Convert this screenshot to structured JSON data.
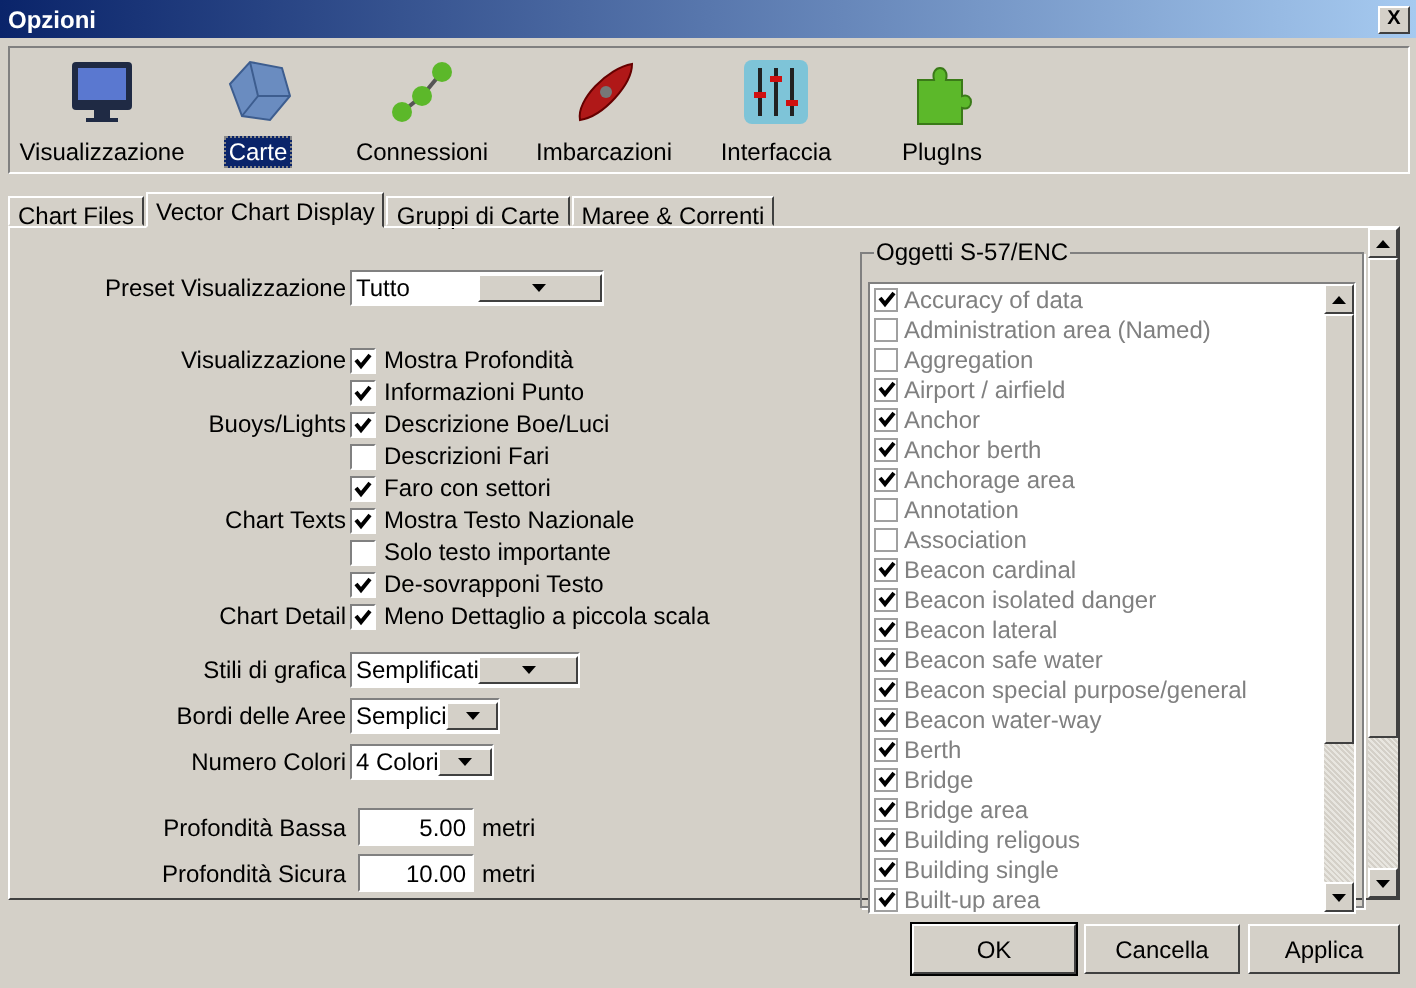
{
  "window": {
    "title": "Opzioni",
    "close": "X"
  },
  "toolbar": [
    {
      "label": "Visualizzazione",
      "selected": false
    },
    {
      "label": "Carte",
      "selected": true
    },
    {
      "label": "Connessioni",
      "selected": false
    },
    {
      "label": "Imbarcazioni",
      "selected": false
    },
    {
      "label": "Interfaccia",
      "selected": false
    },
    {
      "label": "PlugIns",
      "selected": false
    }
  ],
  "tabs": [
    {
      "label": "Chart Files",
      "selected": false
    },
    {
      "label": "Vector Chart Display",
      "selected": true
    },
    {
      "label": "Gruppi di Carte",
      "selected": false
    },
    {
      "label": "Maree & Correnti",
      "selected": false
    }
  ],
  "preset": {
    "label": "Preset Visualizzazione",
    "value": "Tutto"
  },
  "option_groups": [
    {
      "label": "Visualizzazione",
      "options": [
        {
          "label": "Mostra Profondità",
          "checked": true
        },
        {
          "label": "Informazioni Punto",
          "checked": true
        }
      ]
    },
    {
      "label": "Buoys/Lights",
      "options": [
        {
          "label": "Descrizione Boe/Luci",
          "checked": true
        },
        {
          "label": "Descrizioni Fari",
          "checked": false
        },
        {
          "label": "Faro con settori",
          "checked": true
        }
      ]
    },
    {
      "label": "Chart Texts",
      "options": [
        {
          "label": "Mostra Testo Nazionale",
          "checked": true
        },
        {
          "label": "Solo testo importante",
          "checked": false
        },
        {
          "label": "De-sovrapponi Testo",
          "checked": true
        }
      ]
    },
    {
      "label": "Chart Detail",
      "options": [
        {
          "label": "Meno Dettaglio a piccola scala",
          "checked": true
        }
      ]
    }
  ],
  "dropdowns": [
    {
      "label": "Stili di grafica",
      "value": "Semplificati"
    },
    {
      "label": "Bordi delle Aree",
      "value": "Semplici"
    },
    {
      "label": "Numero Colori",
      "value": "4 Colori"
    }
  ],
  "depths": [
    {
      "label": "Profondità Bassa",
      "value": "5.00",
      "unit": "metri"
    },
    {
      "label": "Profondità Sicura",
      "value": "10.00",
      "unit": "metri"
    }
  ],
  "objects": {
    "title": "Oggetti S-57/ENC",
    "items": [
      {
        "label": "Accuracy of data",
        "checked": true
      },
      {
        "label": "Administration area (Named)",
        "checked": false
      },
      {
        "label": "Aggregation",
        "checked": false
      },
      {
        "label": "Airport / airfield",
        "checked": true
      },
      {
        "label": "Anchor",
        "checked": true
      },
      {
        "label": "Anchor berth",
        "checked": true
      },
      {
        "label": "Anchorage area",
        "checked": true
      },
      {
        "label": "Annotation",
        "checked": false
      },
      {
        "label": "Association",
        "checked": false
      },
      {
        "label": "Beacon cardinal",
        "checked": true
      },
      {
        "label": "Beacon isolated danger",
        "checked": true
      },
      {
        "label": "Beacon lateral",
        "checked": true
      },
      {
        "label": "Beacon safe water",
        "checked": true
      },
      {
        "label": "Beacon special purpose/general",
        "checked": true
      },
      {
        "label": "Beacon water-way",
        "checked": true
      },
      {
        "label": "Berth",
        "checked": true
      },
      {
        "label": "Bridge",
        "checked": true
      },
      {
        "label": "Bridge area",
        "checked": true
      },
      {
        "label": "Building religous",
        "checked": true
      },
      {
        "label": "Building single",
        "checked": true
      },
      {
        "label": "Built-up area",
        "checked": true
      }
    ]
  },
  "buttons": [
    {
      "label": "OK",
      "default": true
    },
    {
      "label": "Cancella",
      "default": false
    },
    {
      "label": "Applica",
      "default": false
    }
  ]
}
